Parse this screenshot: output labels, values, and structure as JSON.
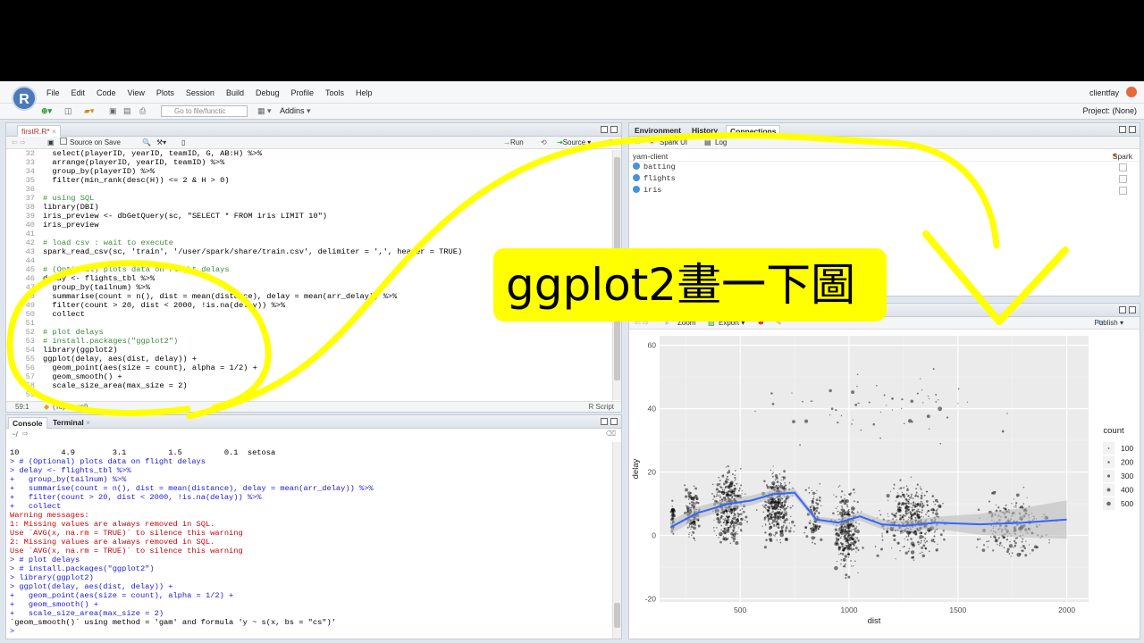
{
  "menu": [
    "File",
    "Edit",
    "Code",
    "View",
    "Plots",
    "Session",
    "Build",
    "Debug",
    "Profile",
    "Tools",
    "Help"
  ],
  "user": "clientfay",
  "toolbar": {
    "goto_placeholder": "Go to file/functic",
    "addins": "Addins",
    "project": "Project: (None)"
  },
  "editor": {
    "tab_label": "firstR.R*",
    "source_on_save": "Source on Save",
    "run_label": "Run",
    "source_label": "Source",
    "position": "59:1",
    "scope": "(Top Level)",
    "filetype": "R Script",
    "lines": [
      {
        "n": "32",
        "t": "  select(playerID, yearID, teamID, G, AB:H) %>%"
      },
      {
        "n": "33",
        "t": "  arrange(playerID, yearID, teamID) %>%"
      },
      {
        "n": "34",
        "t": "  group_by(playerID) %>%"
      },
      {
        "n": "35",
        "t": "  filter(min_rank(desc(H)) <= 2 & H > 0)"
      },
      {
        "n": "36",
        "t": ""
      },
      {
        "n": "37",
        "t": "# using SQL",
        "c": "cm"
      },
      {
        "n": "38",
        "t": "library(DBI)"
      },
      {
        "n": "39",
        "t": "iris_preview <- dbGetQuery(sc, \"SELECT * FROM iris LIMIT 10\")"
      },
      {
        "n": "40",
        "t": "iris_preview"
      },
      {
        "n": "41",
        "t": ""
      },
      {
        "n": "42",
        "t": "# load csv : wait to execute",
        "c": "cm"
      },
      {
        "n": "43",
        "t": "spark_read_csv(sc, 'train', '/user/spark/share/train.csv', delimiter = ',', header = TRUE)"
      },
      {
        "n": "44",
        "t": ""
      },
      {
        "n": "45",
        "t": "# (Optional) plots data on flight delays",
        "c": "cm"
      },
      {
        "n": "46",
        "t": "delay <- flights_tbl %>%"
      },
      {
        "n": "47",
        "t": "  group_by(tailnum) %>%"
      },
      {
        "n": "48",
        "t": "  summarise(count = n(), dist = mean(distance), delay = mean(arr_delay)) %>%"
      },
      {
        "n": "49",
        "t": "  filter(count > 20, dist < 2000, !is.na(delay)) %>%"
      },
      {
        "n": "50",
        "t": "  collect"
      },
      {
        "n": "51",
        "t": ""
      },
      {
        "n": "52",
        "t": "# plot delays",
        "c": "cm"
      },
      {
        "n": "53",
        "t": "# install.packages(\"ggplot2\")",
        "c": "cm"
      },
      {
        "n": "54",
        "t": "library(ggplot2)"
      },
      {
        "n": "55",
        "t": "ggplot(delay, aes(dist, delay)) +"
      },
      {
        "n": "56",
        "t": "  geom_point(aes(size = count), alpha = 1/2) +"
      },
      {
        "n": "57",
        "t": "  geom_smooth() +"
      },
      {
        "n": "58",
        "t": "  scale_size_area(max_size = 2)"
      },
      {
        "n": "59",
        "t": ""
      }
    ]
  },
  "console": {
    "tabs": [
      "Console",
      "Terminal"
    ],
    "path": "~/",
    "lines": [
      {
        "t": "10         4.9        3.1         1.5         0.1  setosa",
        "c": ""
      },
      {
        "t": "> # (Optional) plots data on flight delays",
        "c": "cin"
      },
      {
        "t": "> delay <- flights_tbl %>%",
        "c": "cin"
      },
      {
        "t": "+   group_by(tailnum) %>%",
        "c": "cin"
      },
      {
        "t": "+   summarise(count = n(), dist = mean(distance), delay = mean(arr_delay)) %>%",
        "c": "cin"
      },
      {
        "t": "+   filter(count > 20, dist < 2000, !is.na(delay)) %>%",
        "c": "cin"
      },
      {
        "t": "+   collect",
        "c": "cin"
      },
      {
        "t": "Warning messages:",
        "c": "cerr"
      },
      {
        "t": "1: Missing values are always removed in SQL.",
        "c": "cerr"
      },
      {
        "t": "Use `AVG(x, na.rm = TRUE)` to silence this warning",
        "c": "cerr"
      },
      {
        "t": "2: Missing values are always removed in SQL.",
        "c": "cerr"
      },
      {
        "t": "Use `AVG(x, na.rm = TRUE)` to silence this warning",
        "c": "cerr"
      },
      {
        "t": "> # plot delays",
        "c": "cin"
      },
      {
        "t": "> # install.packages(\"ggplot2\")",
        "c": "cin"
      },
      {
        "t": "> library(ggplot2)",
        "c": "cin"
      },
      {
        "t": "> ggplot(delay, aes(dist, delay)) +",
        "c": "cin"
      },
      {
        "t": "+   geom_point(aes(size = count), alpha = 1/2) +",
        "c": "cin"
      },
      {
        "t": "+   geom_smooth() +",
        "c": "cin"
      },
      {
        "t": "+   scale_size_area(max_size = 2)",
        "c": "cin"
      },
      {
        "t": "`geom_smooth()` using method = 'gam' and formula 'y ~ s(x, bs = \"cs\")'",
        "c": ""
      },
      {
        "t": ">",
        "c": "cin"
      }
    ]
  },
  "environment": {
    "tabs": [
      "Environment",
      "History",
      "Connections"
    ],
    "spark_ui": "Spark UI",
    "log": "Log",
    "connection": "yarn-client",
    "spark": "Spark",
    "tables": [
      "batting",
      "flights",
      "iris"
    ]
  },
  "plots": {
    "zoom": "Zoom",
    "export": "Export",
    "publish": "Publish"
  },
  "callout": "ggplot2畫一下圖",
  "chart_data": {
    "type": "scatter",
    "xlabel": "dist",
    "ylabel": "delay",
    "xlim": [
      130,
      2100
    ],
    "ylim": [
      -21,
      63
    ],
    "xticks": [
      500,
      1000,
      1500,
      2000
    ],
    "yticks": [
      -20,
      0,
      20,
      40,
      60
    ],
    "legend_title": "count",
    "legend_values": [
      100,
      200,
      300,
      400,
      500
    ],
    "legend_position": "right",
    "smooth": {
      "x": [
        180,
        300,
        450,
        550,
        650,
        750,
        850,
        950,
        1050,
        1150,
        1250,
        1400,
        1600,
        1800,
        2000
      ],
      "y": [
        2.5,
        7,
        10,
        11,
        13,
        13.5,
        5,
        4,
        6,
        3.5,
        3,
        4,
        3.5,
        4,
        5
      ]
    },
    "clusters": [
      {
        "x": [
          180,
          200
        ],
        "y": [
          -2,
          12
        ],
        "n": 40
      },
      {
        "x": [
          230,
          330
        ],
        "y": [
          -5,
          18
        ],
        "n": 130
      },
      {
        "x": [
          330,
          560
        ],
        "y": [
          -8,
          26
        ],
        "n": 380
      },
      {
        "x": [
          560,
          780
        ],
        "y": [
          -8,
          26
        ],
        "n": 340
      },
      {
        "x": [
          780,
          900
        ],
        "y": [
          -10,
          22
        ],
        "n": 90
      },
      {
        "x": [
          900,
          1080
        ],
        "y": [
          -18,
          22
        ],
        "n": 300
      },
      {
        "x": [
          1080,
          1500
        ],
        "y": [
          -12,
          22
        ],
        "n": 420
      },
      {
        "x": [
          1500,
          2000
        ],
        "y": [
          -14,
          20
        ],
        "n": 220
      },
      {
        "x": [
          200,
          2000
        ],
        "y": [
          22,
          60
        ],
        "n": 60
      }
    ],
    "band_color": "#b8b8b8",
    "line_color": "#3366ff"
  }
}
